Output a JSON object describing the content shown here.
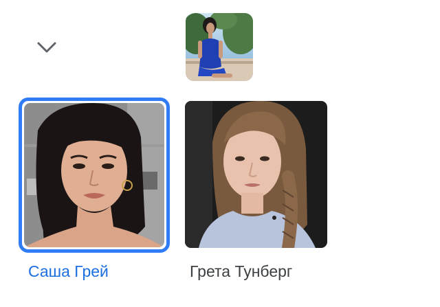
{
  "results": [
    {
      "name": "Саша Грей",
      "selected": true
    },
    {
      "name": "Грета Тунберг",
      "selected": false
    }
  ],
  "colors": {
    "selected_border": "#2f7cf6",
    "selected_label": "#1b6fe0",
    "label": "#3c4043",
    "chevron": "#5f6368"
  },
  "icons": {
    "collapse": "chevron-down-icon"
  }
}
